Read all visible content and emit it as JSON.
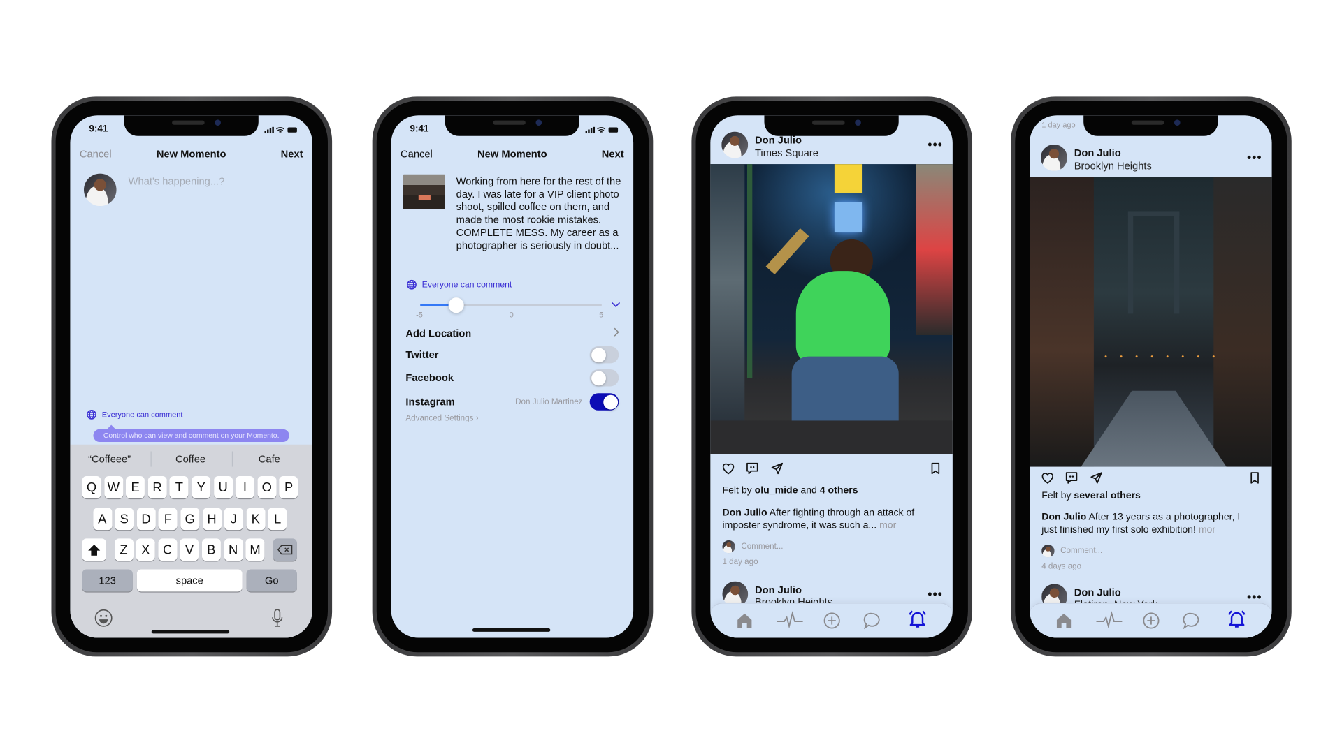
{
  "status_time": "9:41",
  "compose": {
    "nav": {
      "cancel": "Cancel",
      "title": "New Momento",
      "next": "Next"
    },
    "placeholder": "What's happening...?",
    "privacy": "Everyone can comment",
    "tooltip": "Control who can view and comment on your Momento.",
    "suggestions": [
      "“Coffeee”",
      "Coffee",
      "Cafe"
    ],
    "keyboard": {
      "row1": [
        "Q",
        "W",
        "E",
        "R",
        "T",
        "Y",
        "U",
        "I",
        "O",
        "P"
      ],
      "row2": [
        "A",
        "S",
        "D",
        "F",
        "G",
        "H",
        "J",
        "K",
        "L"
      ],
      "row3": [
        "Z",
        "X",
        "C",
        "V",
        "B",
        "N",
        "M"
      ],
      "numbers": "123",
      "space": "space",
      "go": "Go"
    }
  },
  "details": {
    "nav": {
      "cancel": "Cancel",
      "title": "New Momento",
      "next": "Next"
    },
    "post_text": "Working from here for the rest of the day. I was late for a VIP client photo shoot, spilled coffee on them, and made the most rookie mistakes. COMPLETE MESS. My career as a photographer is seriously in doubt...",
    "privacy": "Everyone can comment",
    "slider": {
      "min": -5,
      "mid": 0,
      "max": 5,
      "value": -3,
      "min_label": "-5",
      "mid_label": "0",
      "max_label": "5"
    },
    "add_location": "Add Location",
    "twitter": {
      "label": "Twitter",
      "on": false
    },
    "facebook": {
      "label": "Facebook",
      "on": false
    },
    "instagram": {
      "label": "Instagram",
      "account": "Don Julio Martinez",
      "on": true
    },
    "advanced": "Advanced Settings"
  },
  "feed1": {
    "post": {
      "author": "Don Julio",
      "location": "Times Square",
      "felt_prefix": "Felt by ",
      "felt_user": "olu_mide",
      "felt_mid": " and ",
      "felt_rest": "4 others",
      "caption": " After fighting through an attack of imposter syndrome, it was such a...",
      "more": " mor",
      "comment_placeholder": "Comment...",
      "time": "1 day ago"
    },
    "next_post": {
      "author": "Don Julio",
      "location": "Brooklyn Heights"
    }
  },
  "feed2": {
    "top_time": "1 day ago",
    "post": {
      "author": "Don Julio",
      "location": "Brooklyn Heights",
      "felt_prefix": "Felt by ",
      "felt_rest": "several others",
      "caption": " After 13 years as a photographer, I just finished my first solo exhibition!",
      "more": "  mor",
      "comment_placeholder": "Comment...",
      "time": "4 days ago"
    },
    "next_post": {
      "author": "Don Julio",
      "location": "Flatiron, New York"
    }
  },
  "tabbar": {
    "icons": [
      "home-icon",
      "activity-icon",
      "add-icon",
      "chat-icon",
      "bell-icon"
    ],
    "active": "bell-icon"
  },
  "colors": {
    "screen_bg": "#d5e4f7",
    "accent": "#3b2fd4",
    "toggle_on": "#0d0db5",
    "tooltip": "#8d86f0"
  }
}
